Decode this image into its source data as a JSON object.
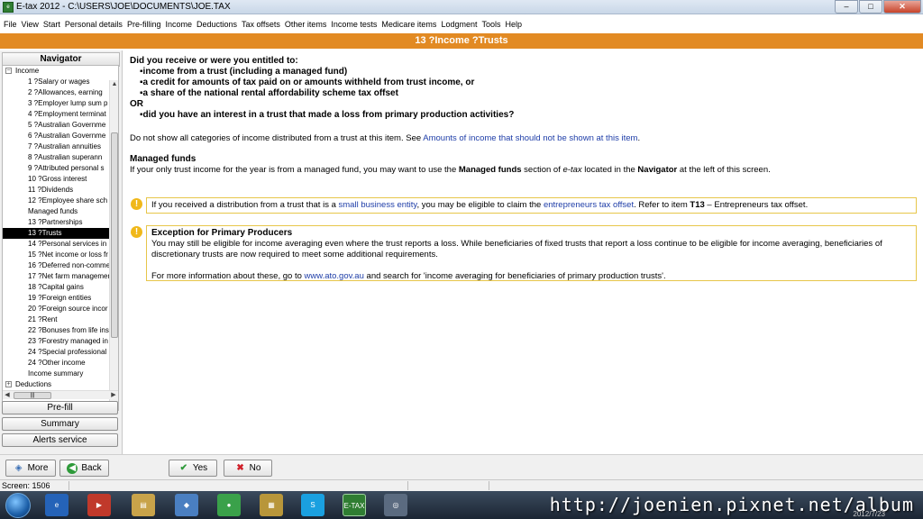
{
  "window": {
    "title": "E-tax 2012 - C:\\USERS\\JOE\\DOCUMENTS\\JOE.TAX",
    "minimize": "–",
    "maximize": "□",
    "close": "✕"
  },
  "menu": [
    "File",
    "View",
    "Start",
    "Personal details",
    "Pre-filling",
    "Income",
    "Deductions",
    "Tax offsets",
    "Other items",
    "Income tests",
    "Medicare items",
    "Lodgment",
    "Tools",
    "Help"
  ],
  "header": {
    "title": "13 ?Income ?Trusts"
  },
  "navigator": {
    "title": "Navigator",
    "income_group": "Income",
    "income_items": [
      "1 ?Salary or wages",
      "2 ?Allowances, earning",
      "3 ?Employer lump sum p",
      "4 ?Employment terminat",
      "5 ?Australian Governme",
      "6 ?Australian Governme",
      "7 ?Australian annuities",
      "8 ?Australian superann",
      "9 ?Attributed personal s",
      "10 ?Gross interest",
      "11 ?Dividends",
      "12 ?Employee share sch",
      "Managed funds",
      "13 ?Partnerships",
      "13 ?Trusts",
      "14 ?Personal services in",
      "15 ?Net income or loss fr",
      "16 ?Deferred non-comme",
      "17 ?Net farm managemer",
      "18 ?Capital gains",
      "19 ?Foreign entities",
      "20 ?Foreign source incor",
      "21 ?Rent",
      "22 ?Bonuses from life ins",
      "23 ?Forestry managed in",
      "24 ?Special professional",
      "24 ?Other income",
      "Income summary"
    ],
    "selected_index": 14,
    "deductions_group": "Deductions",
    "buttons": {
      "prefill": "Pre-fill",
      "summary": "Summary",
      "alerts": "Alerts service"
    }
  },
  "content": {
    "question": "Did you receive or were you entitled to:",
    "bullets": [
      "income from a trust (including a managed fund)",
      "a credit for amounts of tax paid on or amounts withheld from trust income, or",
      "a share of the national rental affordability scheme tax offset"
    ],
    "or": "OR",
    "loss_bullet": "did you have an interest in a trust that made a loss from primary production activities?",
    "note_pre": "Do not show all categories of income distributed from a trust at this item. See ",
    "note_link": "Amounts of income that should not be shown at this item",
    "note_post": ".",
    "managed_heading": "Managed funds",
    "managed_pre": "If your only trust income for the year is from a managed fund, you may want to use the ",
    "managed_bold1": "Managed funds",
    "managed_mid1": " section of ",
    "managed_italic": "e-tax",
    "managed_mid2": " located in the ",
    "managed_bold2": "Navigator",
    "managed_post": " at the left of this screen.",
    "info1_pre": "If you received a distribution from a trust that is a ",
    "info1_link1": "small business entity",
    "info1_mid": ", you may be eligible to claim the ",
    "info1_link2": "entrepreneurs tax offset",
    "info1_mid2": ". Refer to item ",
    "info1_bold": "T13",
    "info1_post": " – Entrepreneurs tax offset.",
    "info2_heading": "Exception for Primary Producers",
    "info2_text": "You may still be eligible for income averaging even where the trust reports a loss. While beneficiaries of fixed trusts that report a loss continue to be eligible for income averaging, beneficiaries of discretionary trusts are now required to meet some additional requirements.",
    "info2_more_pre": "For more information about these, go to ",
    "info2_more_link": "www.ato.gov.au",
    "info2_more_post": " and search for 'income averaging for beneficiaries of primary production trusts'."
  },
  "buttons": {
    "more": "More",
    "back": "Back",
    "yes": "Yes",
    "no": "No"
  },
  "status": {
    "screen": "Screen: 1506"
  },
  "taskbar": {
    "watermark": "http://joenien.pixnet.net/album",
    "clock": "2012/7/23"
  },
  "colors": {
    "header_orange": "#e28a23",
    "link_blue": "#1f3ea8",
    "warn_yellow": "#f0b81a"
  }
}
